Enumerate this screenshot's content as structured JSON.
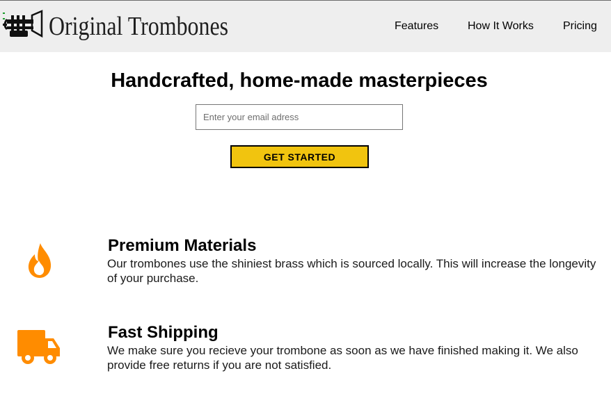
{
  "header": {
    "brand": "Original Trombones",
    "nav": [
      {
        "label": "Features"
      },
      {
        "label": "How It Works"
      },
      {
        "label": "Pricing"
      }
    ]
  },
  "hero": {
    "title": "Handcrafted, home-made masterpieces",
    "email_placeholder": "Enter your email adress",
    "email_value": "",
    "cta_label": "GET STARTED"
  },
  "features": [
    {
      "icon": "flame-icon",
      "title": "Premium Materials",
      "description": "Our trombones use the shiniest brass which is sourced locally. This will increase the longevity of your purchase."
    },
    {
      "icon": "truck-icon",
      "title": "Fast Shipping",
      "description": "We make sure you recieve your trombone as soon as we have finished making it. We also provide free returns if you are not satisfied."
    }
  ],
  "colors": {
    "header_bg": "#eeeeee",
    "cta_bg": "#f1c40f",
    "icon_orange": "#ff8c00"
  }
}
